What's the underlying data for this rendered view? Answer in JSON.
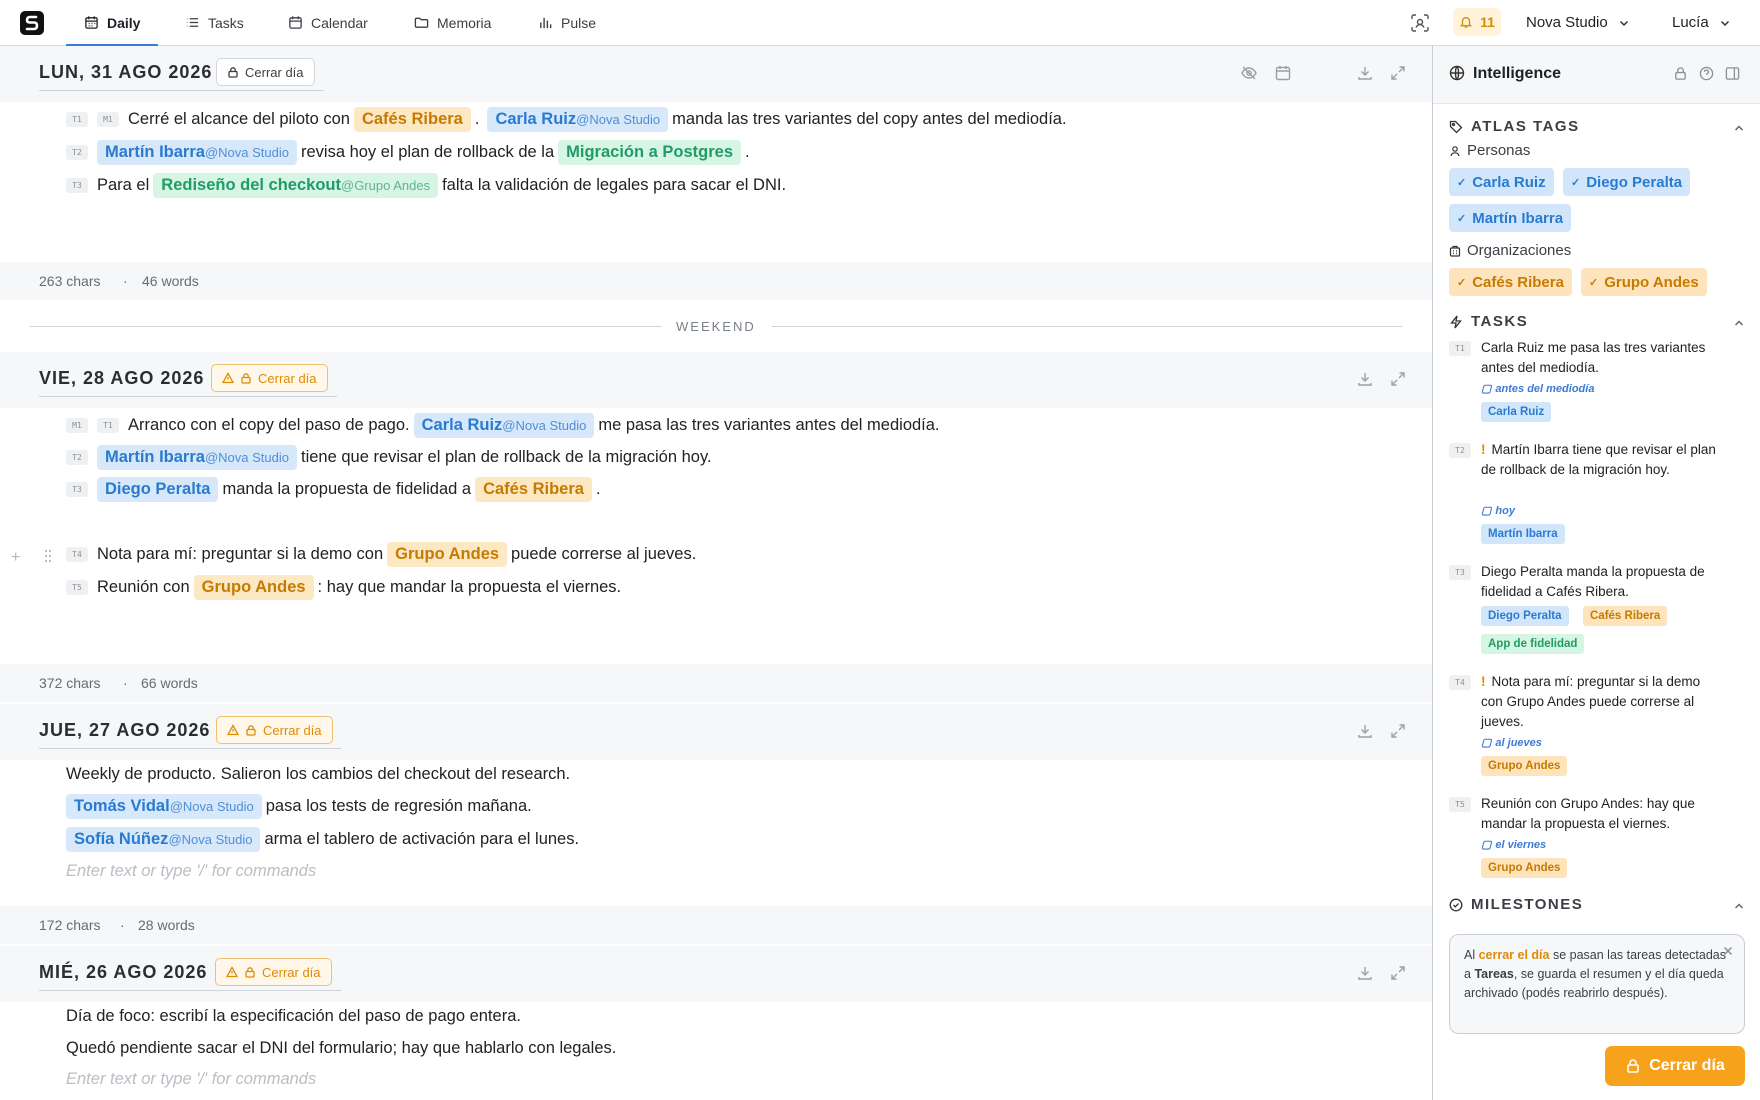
{
  "nav": {
    "daily": "Daily",
    "tasks": "Tasks",
    "calendar": "Calendar",
    "memoria": "Memoria",
    "pulse": "Pulse",
    "notif_count": "11",
    "org": "Nova Studio",
    "user": "Lucía"
  },
  "days": [
    {
      "date": "LUN, 31 AGO 2026",
      "close": "Cerrar día",
      "chars": "263 chars",
      "words": "46 words",
      "l1": {
        "b1": "T1",
        "b2": "M1",
        "t1": "Cerré el alcance del piloto con",
        "c1": "Cafés Ribera",
        "t2": ".",
        "c2": "Carla Ruiz",
        "c2at": "@Nova Studio",
        "t3": "manda las tres variantes del copy antes del mediodía."
      },
      "l2": {
        "b1": "T2",
        "c1": "Martín Ibarra",
        "c1at": "@Nova Studio",
        "t1": "revisa hoy el plan de rollback de la",
        "c2": "Migración a Postgres",
        "t2": "."
      },
      "l3": {
        "b1": "T3",
        "t1": "Para el",
        "c1": "Rediseño del checkout",
        "c1at": "@Grupo Andes",
        "t2": "falta la validación de legales para sacar el DNI."
      }
    },
    {
      "date": "VIE, 28 AGO 2026",
      "close": "Cerrar día",
      "chars": "372 chars",
      "words": "66 words",
      "l1": {
        "b1": "M1",
        "b2": "T1",
        "t1": "Arranco con el copy del paso de pago.",
        "c1": "Carla Ruiz",
        "c1at": "@Nova Studio",
        "t2": "me pasa las tres variantes antes del mediodía."
      },
      "l2": {
        "b1": "T2",
        "c1": "Martín Ibarra",
        "c1at": "@Nova Studio",
        "t1": "tiene que revisar el plan de rollback de la migración hoy."
      },
      "l3": {
        "b1": "T3",
        "c1": "Diego Peralta",
        "t1": "manda la propuesta de fidelidad a",
        "c2": "Cafés Ribera",
        "t2": "."
      },
      "l4": {
        "b1": "T4",
        "t1": "Nota para mí: preguntar si la demo con",
        "c1": "Grupo Andes",
        "t2": "puede correrse al jueves."
      },
      "l5": {
        "b1": "T5",
        "t1": "Reunión con",
        "c1": "Grupo Andes",
        "t2": ": hay que mandar la propuesta el viernes."
      }
    },
    {
      "date": "JUE, 27 AGO 2026",
      "close": "Cerrar día",
      "chars": "172 chars",
      "words": "28 words",
      "l1": {
        "t1": "Weekly de producto. Salieron los cambios del checkout del research."
      },
      "l2": {
        "c1": "Tomás Vidal",
        "c1at": "@Nova Studio",
        "t1": "pasa los tests de regresión mañana."
      },
      "l3": {
        "c1": "Sofía Núñez",
        "c1at": "@Nova Studio",
        "t1": "arma el tablero de activación para el lunes."
      },
      "placeholder": "Enter text or type '/' for commands"
    },
    {
      "date": "MIÉ, 26 AGO 2026",
      "close": "Cerrar día",
      "l1": {
        "t1": "Día de foco: escribí la especificación del paso de pago entera."
      },
      "l2": {
        "t1": "Quedó pendiente sacar el DNI del formulario; hay que hablarlo con legales."
      },
      "placeholder": "Enter text or type '/' for commands"
    }
  ],
  "weekend": "WEEKEND",
  "dot": "·",
  "side": {
    "title": "Intelligence",
    "atlas": "ATLAS TAGS",
    "personas": "Personas",
    "orgs": "Organizaciones",
    "people": [
      "Carla Ruiz",
      "Diego Peralta",
      "Martín Ibarra"
    ],
    "organizations": [
      "Cafés Ribera",
      "Grupo Andes"
    ],
    "tasks_title": "TASKS",
    "tasks": [
      {
        "id": "T1",
        "text": "Carla Ruiz me pasa las tres variantes antes del mediodía.",
        "due": "antes del mediodía",
        "tags": [
          "Carla Ruiz"
        ]
      },
      {
        "id": "T2",
        "text": "Martín Ibarra tiene que revisar el plan de rollback de la migración hoy.",
        "due": "hoy",
        "tags": [
          "Martín Ibarra"
        ]
      },
      {
        "id": "T3",
        "text": "Diego Peralta manda la propuesta de fidelidad a Cafés Ribera.",
        "tags": [
          "Diego Peralta",
          "Cafés Ribera",
          "App de fidelidad"
        ]
      },
      {
        "id": "T4",
        "text": "Nota para mí: preguntar si la demo con Grupo Andes puede correrse al jueves.",
        "due": "al jueves",
        "tags": [
          "Grupo Andes"
        ]
      },
      {
        "id": "T5",
        "text": "Reunión con Grupo Andes: hay que mandar la propuesta el viernes.",
        "due": "el viernes",
        "tags": [
          "Grupo Andes"
        ]
      }
    ],
    "milestones": "MILESTONES",
    "note": {
      "a": "Al ",
      "b": "cerrar el día",
      "c": " se pasan las tareas detectadas a ",
      "d": "Tareas",
      "e": ", se guarda el resumen y el día queda archivado (podés reabrirlo después)."
    },
    "cta": "Cerrar día"
  },
  "colors": {
    "accent": "#3b7bd6",
    "warn": "#f7a21b",
    "person": "#2a7bd0",
    "org": "#c77a00",
    "project": "#1f9d63"
  }
}
